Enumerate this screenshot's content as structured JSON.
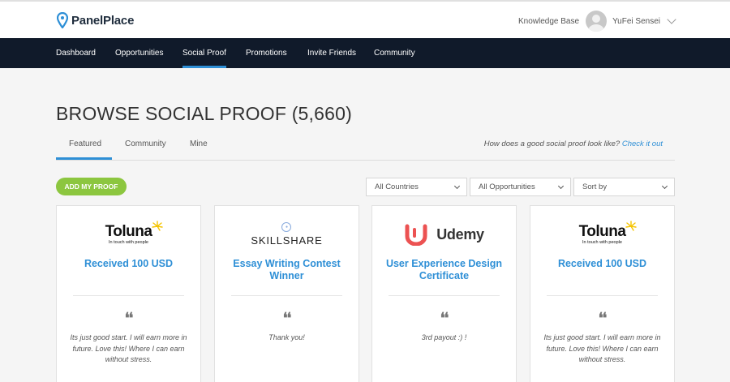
{
  "header": {
    "logo_text": "PanelPlace",
    "knowledge_base": "Knowledge Base",
    "user_name": "YuFei Sensei"
  },
  "nav": {
    "items": [
      "Dashboard",
      "Opportunities",
      "Social Proof",
      "Promotions",
      "Invite Friends",
      "Community"
    ],
    "active": "Social Proof"
  },
  "page": {
    "title": "BROWSE SOCIAL PROOF (5,660)"
  },
  "tabs": {
    "items": [
      "Featured",
      "Community",
      "Mine"
    ],
    "active": "Featured",
    "hint": "How does a good social proof look like?",
    "hint_link": "Check it out"
  },
  "actions": {
    "add_label": "ADD MY PROOF"
  },
  "filters": {
    "countries": "All Countries",
    "opportunities": "All Opportunities",
    "sort": "Sort by"
  },
  "cards": [
    {
      "brand": "Toluna",
      "brand_tagline": "In touch with people",
      "title": "Received 100 USD",
      "text": "Its just good start. I will earn more in future. Love this! Where I can earn without stress."
    },
    {
      "brand": "SKILLSHARE",
      "title": "Essay Writing Contest Winner",
      "text": "Thank you!"
    },
    {
      "brand": "Udemy",
      "title": "User Experience Design Certificate",
      "text": "3rd payout :) !"
    },
    {
      "brand": "Toluna",
      "brand_tagline": "In touch with people",
      "title": "Received 100 USD",
      "text": "Its just good start. I will earn more in future. Love this! Where I can earn without stress."
    }
  ],
  "colors": {
    "nav_bg": "#101a2a",
    "accent": "#2e8fd6",
    "add_button": "#8cc63f",
    "udemy_red": "#ec5252",
    "toluna_star": "#f5c400"
  },
  "icons": {
    "logo": "map-pin-icon",
    "avatar": "user-avatar-icon",
    "dropdown": "chevron-down-icon",
    "quote": "quote-icon"
  }
}
